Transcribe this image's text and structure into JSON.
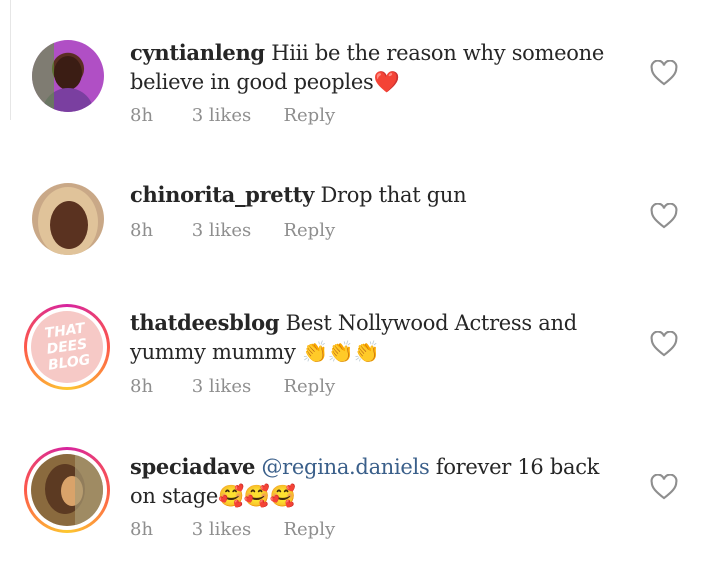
{
  "comments": [
    {
      "username": "cyntianleng",
      "text": "Hiii be the reason why someone believe in good peoples",
      "emoji": "❤️",
      "time": "8h",
      "likes": "3 likes",
      "reply": "Reply"
    },
    {
      "username": "chinorita_pretty",
      "text": "Drop that gun",
      "emoji": "",
      "time": "8h",
      "likes": "3 likes",
      "reply": "Reply"
    },
    {
      "username": "thatdeesblog",
      "text": "Best Nollywood Actress and yummy mummy",
      "emoji": "👏👏👏",
      "time": "8h",
      "likes": "3 likes",
      "reply": "Reply",
      "avatar_logo": "THAT DEES BLOG"
    },
    {
      "username": "speciadave",
      "mention": "@regina.daniels",
      "text": "forever 16 back on stage",
      "emoji": "🥰🥰🥰",
      "time": "8h",
      "likes": "3 likes",
      "reply": "Reply"
    }
  ],
  "colors": {
    "meta_gray": "#8e8e8e",
    "mention_blue": "#3a5f8a",
    "ring_gradient": "#d6249f"
  }
}
